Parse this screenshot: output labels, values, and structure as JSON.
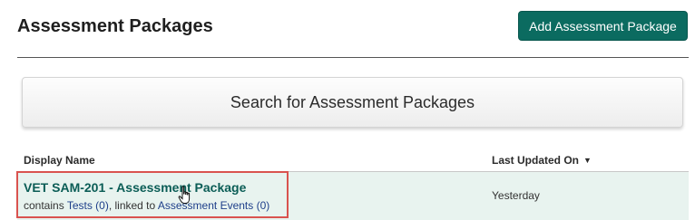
{
  "header": {
    "title": "Assessment Packages",
    "add_button_label": "Add Assessment Package"
  },
  "search": {
    "label": "Search for Assessment Packages"
  },
  "table": {
    "columns": {
      "display_name": "Display Name",
      "last_updated": "Last Updated On",
      "sort_indicator": "▼"
    },
    "rows": [
      {
        "name": "VET SAM-201 - Assessment Package",
        "contains_prefix": "contains ",
        "tests_link": "Tests (0)",
        "linked_prefix": ", linked to ",
        "events_link": "Assessment Events (0)",
        "last_updated": "Yesterday"
      }
    ]
  },
  "colors": {
    "accent": "#0b6b60",
    "row_background": "#e8f3ef",
    "highlight_border": "#d9534f",
    "link": "#1e3f8a"
  }
}
